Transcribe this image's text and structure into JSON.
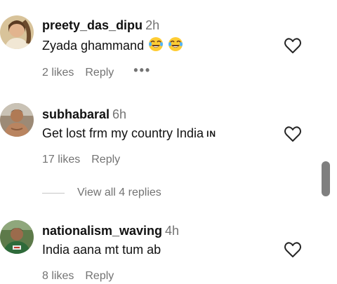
{
  "comments": [
    {
      "username": "preety_das_dipu",
      "time": "2h",
      "text": "Zyada ghammand",
      "emojis": [
        "face-with-tears-of-joy",
        "face-with-tears-of-joy"
      ],
      "likes": "2 likes",
      "reply": "Reply",
      "more": "•••"
    },
    {
      "username": "subhabaral",
      "time": "6h",
      "text": "Get lost frm my country India",
      "flag": "IN",
      "likes": "17 likes",
      "reply": "Reply",
      "view_replies": "View all 4 replies"
    },
    {
      "username": "nationalism_waving",
      "time": "4h",
      "text": "India aana mt tum ab",
      "likes": "8 likes",
      "reply": "Reply"
    }
  ],
  "colors": {
    "text": "#111111",
    "muted": "#737373",
    "divider": "#c7c7c7",
    "scrollbar": "#7f7f7f"
  },
  "icons": {
    "like": "heart-outline-icon",
    "more": "more-options-icon"
  }
}
